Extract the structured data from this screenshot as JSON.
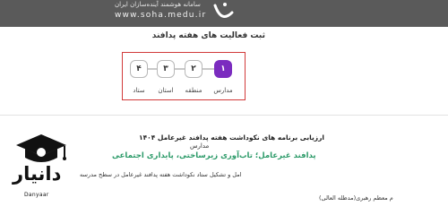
{
  "header": {
    "tagline": "سامانه هوشمند آینده‌سازان ایران",
    "url": "www.soha.medu.ir"
  },
  "page": {
    "title": "ثبت فعالیت های هفته پدافند"
  },
  "stepper": {
    "steps": [
      {
        "number": "۱",
        "label": "مدارس",
        "active": true
      },
      {
        "number": "۲",
        "label": "منطقه",
        "active": false
      },
      {
        "number": "۳",
        "label": "استان",
        "active": false
      },
      {
        "number": "۴",
        "label": "ستاد",
        "active": false
      }
    ],
    "active_color": "#7b2cbf",
    "box_color": "#d23a3a"
  },
  "document": {
    "title": "ارزیابی برنامه های نکوداشت هفته پدافند غیرعامل ۱۴۰۴",
    "subtitle": "مدارس",
    "highlight": "پدافند غیرعامل؛ تاب‌آوری زیرساختی، پایداری اجتماعی",
    "line1": "امل و تشکیل ستاد نکوداشت هفته پدافند غیرعامل در سطح مدرسه",
    "line2": "م معظم رهبری(مدظله العالی)",
    "highlight_color": "#2b9a68"
  },
  "watermark": {
    "brand_fa": "دانیار",
    "brand_en": "Danyaar"
  }
}
